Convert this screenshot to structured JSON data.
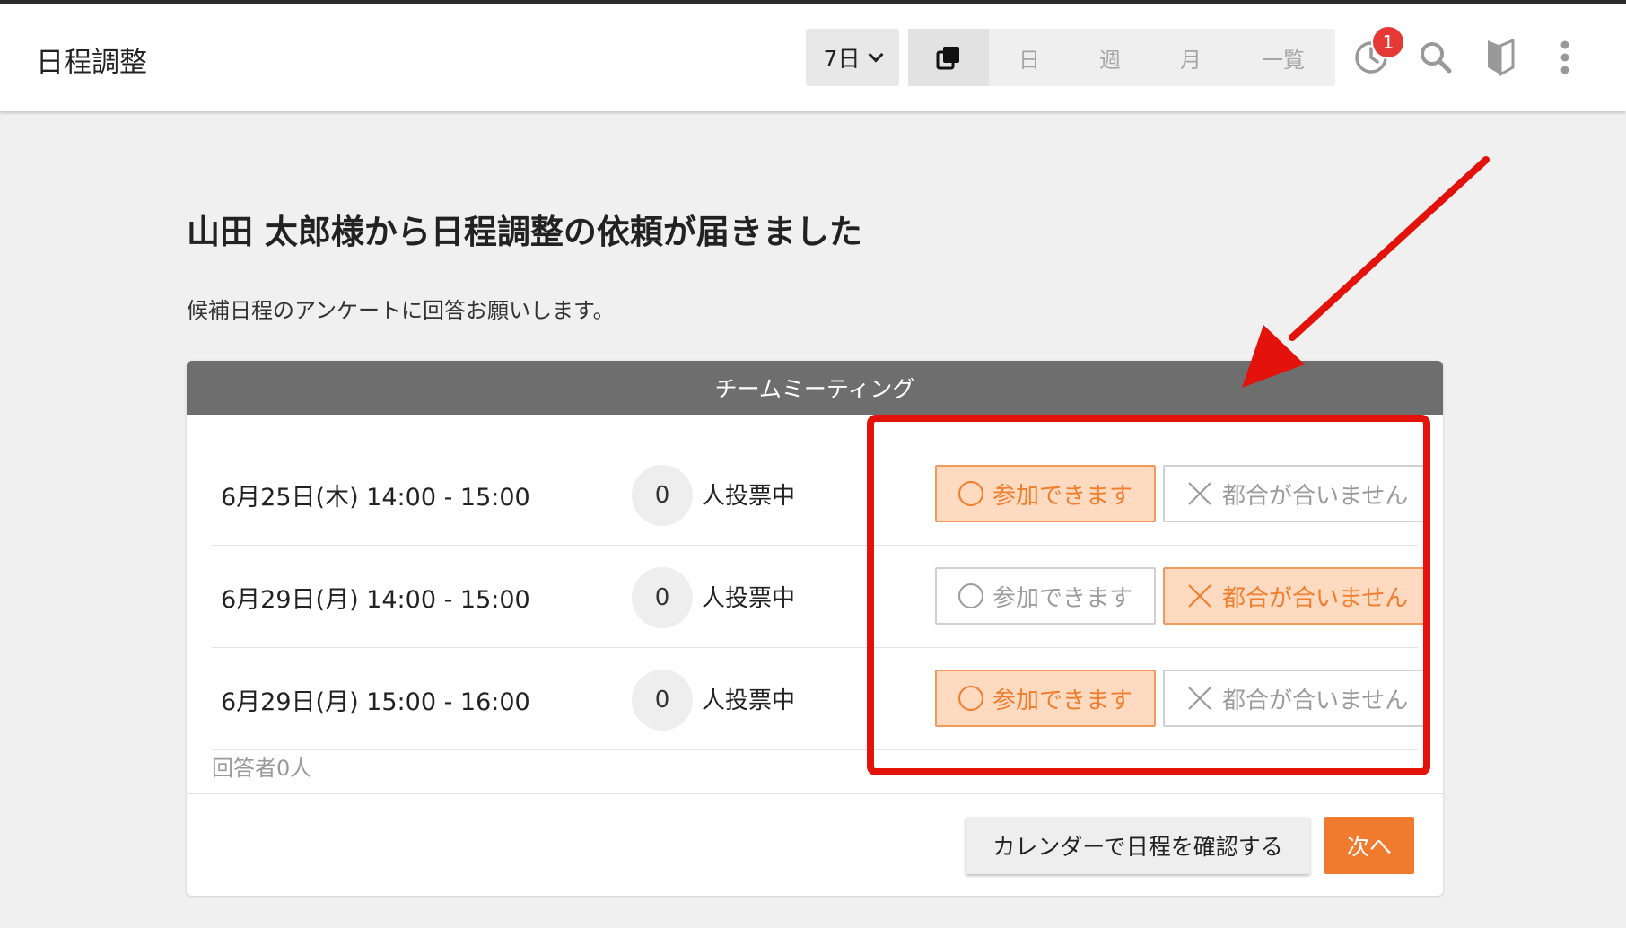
{
  "header": {
    "app_title": "日程調整",
    "range": {
      "selected": "7日"
    },
    "views": [
      {
        "label": "日"
      },
      {
        "label": "週"
      },
      {
        "label": "月"
      },
      {
        "label": "一覧"
      }
    ],
    "notification_count": "1"
  },
  "main": {
    "heading": "山田 太郎様から日程調整の依頼が届きました",
    "subheading": "候補日程のアンケートに回答お願いします。"
  },
  "survey": {
    "title": "チームミーティング",
    "yes_label": "参加できます",
    "no_label": "都合が合いません",
    "votes_suffix": "人投票中",
    "rows": [
      {
        "date": "6月25日(木) 14:00 - 15:00",
        "votes": "0",
        "selected": "yes"
      },
      {
        "date": "6月29日(月) 14:00 - 15:00",
        "votes": "0",
        "selected": "no"
      },
      {
        "date": "6月29日(月) 15:00 - 16:00",
        "votes": "0",
        "selected": "yes"
      }
    ],
    "respondents": "回答者0人"
  },
  "actions": {
    "calendar_button": "カレンダーで日程を確認する",
    "next_button": "次へ"
  },
  "colors": {
    "accent": "#f07a2e",
    "selected_bg": "#fddac0",
    "annotation_red": "#e3120b"
  }
}
